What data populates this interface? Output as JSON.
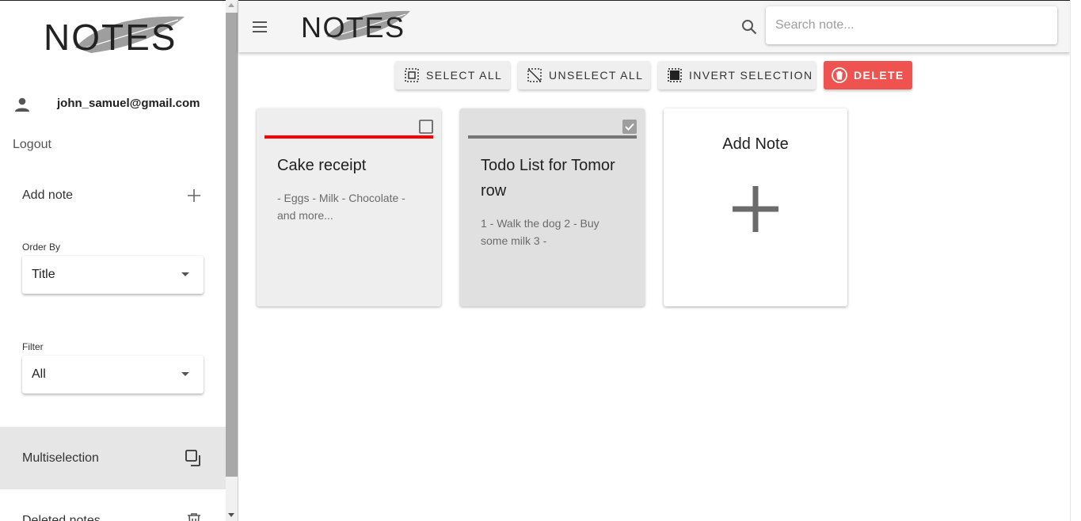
{
  "app": {
    "logo_text": "NOTES"
  },
  "sidebar": {
    "user_email": "john_samuel@gmail.com",
    "logout_label": "Logout",
    "add_note_label": "Add note",
    "order_by": {
      "label": "Order By",
      "value": "Title"
    },
    "filter": {
      "label": "Filter",
      "value": "All"
    },
    "multiselection_label": "Multiselection",
    "deleted_notes_label": "Deleted notes"
  },
  "header": {
    "search_placeholder": "Search note..."
  },
  "toolbar": {
    "select_all": "SELECT ALL",
    "unselect_all": "UNSELECT ALL",
    "invert_selection": "INVERT SELECTION",
    "delete": "DELETE"
  },
  "notes": [
    {
      "title": "Cake receipt",
      "body": "- Eggs - Milk - Chocolate - and more...",
      "color": "#ff0000",
      "selected": false
    },
    {
      "title": "Todo List for Tomor row",
      "body": "1 - Walk the dog 2 - Buy some milk 3 -",
      "color": "#757575",
      "selected": true
    }
  ],
  "add_card": {
    "label": "Add Note"
  },
  "colors": {
    "delete": "#ef5350",
    "selected_card": "#e0e0e0",
    "card": "#eeeeee"
  },
  "icons": [
    "menu-icon",
    "search-icon",
    "person-icon",
    "plus-icon",
    "caret-down-icon",
    "multiselect-icon",
    "trash-icon",
    "checkbox-icon"
  ]
}
